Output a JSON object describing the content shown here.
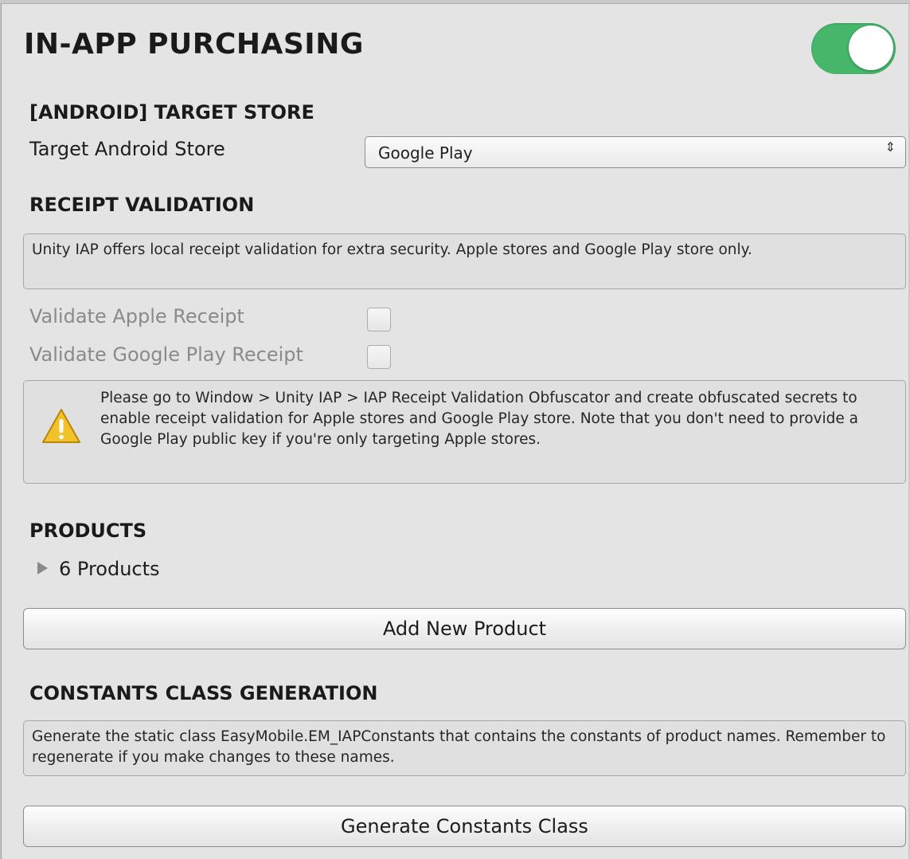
{
  "module": {
    "title": "IN-APP PURCHASING",
    "enabled": true,
    "toggle_color": "#46b76a"
  },
  "target_store": {
    "header": "[ANDROID] TARGET STORE",
    "label": "Target Android Store",
    "selected": "Google Play",
    "arrow": "⇕"
  },
  "receipt_validation": {
    "header": "RECEIPT VALIDATION",
    "info": "Unity IAP offers local receipt validation for extra security. Apple stores and Google Play store only.",
    "validate_apple_label": "Validate Apple Receipt",
    "validate_apple_checked": false,
    "validate_google_label": "Validate Google Play Receipt",
    "validate_google_checked": false,
    "warning": "Please go to Window > Unity IAP > IAP Receipt Validation Obfuscator and create obfuscated secrets to enable receipt validation for Apple stores and Google Play store. Note that you don't need to provide a Google Play public key if you're only targeting Apple stores.",
    "warning_icon": "warning-triangle-icon"
  },
  "products": {
    "header": "PRODUCTS",
    "foldout_label": "6 Products",
    "foldout_icon": "triangle-right-icon",
    "add_button": "Add New Product"
  },
  "constants": {
    "header": "CONSTANTS CLASS GENERATION",
    "info": "Generate the static class EasyMobile.EM_IAPConstants that contains the constants of product names. Remember to regenerate if you make changes to these names.",
    "generate_button": "Generate Constants Class"
  }
}
